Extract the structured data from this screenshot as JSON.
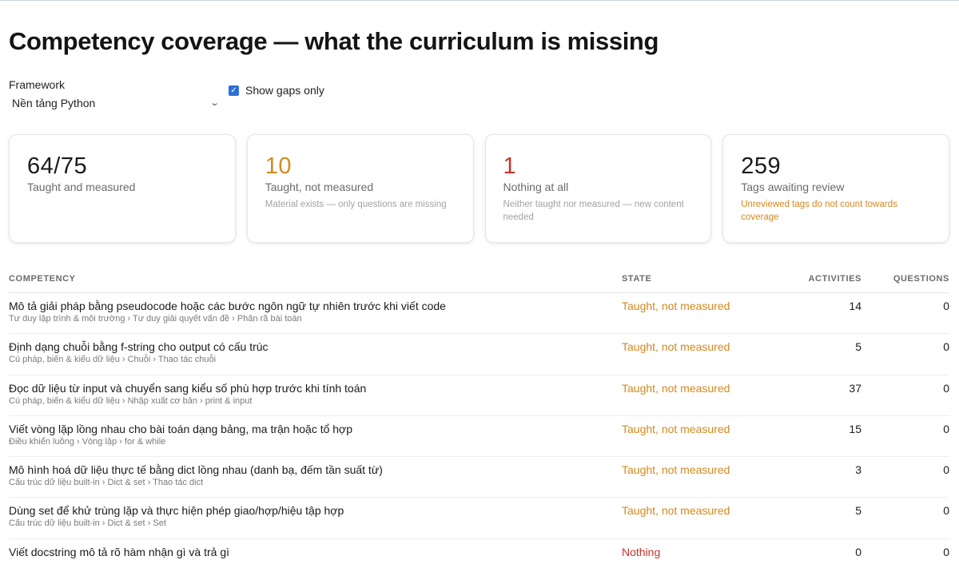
{
  "page": {
    "title": "Competency coverage — what the curriculum is missing"
  },
  "filters": {
    "framework_label": "Framework",
    "framework_value": "Nền tảng Python",
    "gaps_only_label": "Show gaps only",
    "gaps_only_checked": true
  },
  "cards": [
    {
      "value": "64/75",
      "label": "Taught and measured",
      "note": "",
      "tone": "neutral"
    },
    {
      "value": "10",
      "label": "Taught, not measured",
      "note": "Material exists — only questions are missing",
      "tone": "orange"
    },
    {
      "value": "1",
      "label": "Nothing at all",
      "note": "Neither taught nor measured — new content needed",
      "tone": "red"
    },
    {
      "value": "259",
      "label": "Tags awaiting review",
      "note": "Unreviewed tags do not count towards coverage",
      "tone": "neutral",
      "note_tone": "orange"
    }
  ],
  "table": {
    "headers": {
      "competency": "COMPETENCY",
      "state": "STATE",
      "activities": "ACTIVITIES",
      "questions": "QUESTIONS"
    },
    "rows": [
      {
        "title": "Mô tả giải pháp bằng pseudocode hoặc các bước ngôn ngữ tự nhiên trước khi viết code",
        "path": "Tư duy lập trình & môi trường › Tư duy giải quyết vấn đề › Phân rã bài toán",
        "state": "Taught, not measured",
        "state_tone": "orange",
        "activities": "14",
        "questions": "0"
      },
      {
        "title": "Định dạng chuỗi bằng f-string cho output có cấu trúc",
        "path": "Cú pháp, biến & kiểu dữ liệu › Chuỗi › Thao tác chuỗi",
        "state": "Taught, not measured",
        "state_tone": "orange",
        "activities": "5",
        "questions": "0"
      },
      {
        "title": "Đọc dữ liệu từ input và chuyển sang kiểu số phù hợp trước khi tính toán",
        "path": "Cú pháp, biến & kiểu dữ liệu › Nhập xuất cơ bản › print & input",
        "state": "Taught, not measured",
        "state_tone": "orange",
        "activities": "37",
        "questions": "0"
      },
      {
        "title": "Viết vòng lặp lồng nhau cho bài toán dạng bảng, ma trận hoặc tổ hợp",
        "path": "Điều khiển luồng › Vòng lặp › for & while",
        "state": "Taught, not measured",
        "state_tone": "orange",
        "activities": "15",
        "questions": "0"
      },
      {
        "title": "Mô hình hoá dữ liệu thực tế bằng dict lồng nhau (danh bạ, đếm tần suất từ)",
        "path": "Cấu trúc dữ liệu built-in › Dict & set › Thao tác dict",
        "state": "Taught, not measured",
        "state_tone": "orange",
        "activities": "3",
        "questions": "0"
      },
      {
        "title": "Dùng set để khử trùng lặp và thực hiện phép giao/hợp/hiệu tập hợp",
        "path": "Cấu trúc dữ liệu built-in › Dict & set › Set",
        "state": "Taught, not measured",
        "state_tone": "orange",
        "activities": "5",
        "questions": "0"
      },
      {
        "title": "Viết docstring mô tả rõ hàm nhận gì và trả gì",
        "path": "",
        "state": "Nothing",
        "state_tone": "red",
        "activities": "0",
        "questions": "0"
      }
    ]
  }
}
